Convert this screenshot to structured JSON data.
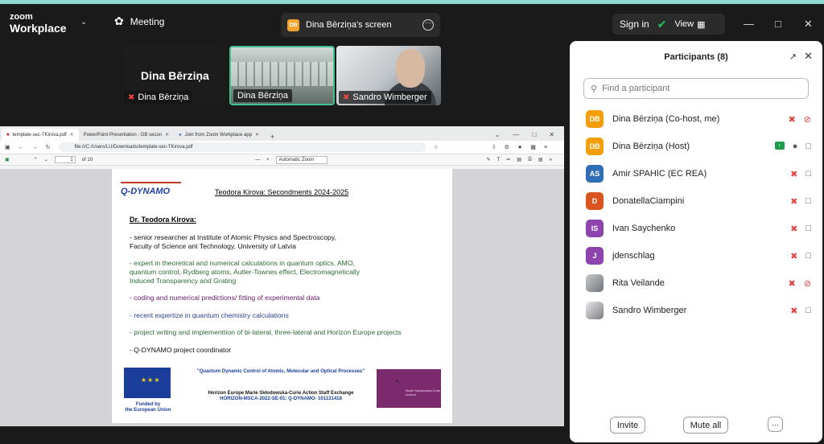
{
  "app": {
    "brand_top": "zoom",
    "brand_bottom": "Workplace",
    "meeting_label": "Meeting",
    "share_badge": "DB",
    "share_title": "Dina Bērziņa's screen",
    "sign_in": "Sign in",
    "view": "View"
  },
  "thumbs": [
    {
      "big_name": "Dina Bērziņa",
      "tag": "Dina Bērziņa"
    },
    {
      "tag": "Dina Bērziņa"
    },
    {
      "tag": "Sandro Wimberger"
    }
  ],
  "browser": {
    "tabs": [
      "template-sec-TKirova.pdf",
      "PowerPoint Presentation - DB secon",
      "Join from Zoom Workplace app"
    ],
    "url": "file:///C:/Users/LU/Downloads/template-sec-TKirova.pdf",
    "page_current": "1",
    "page_total": "of 10",
    "zoom": "Automatic Zoom"
  },
  "doc": {
    "logo": "Q-DYNAMO",
    "title": "Teodora Kirova: Secondments 2024-2025",
    "name": "Dr. Teodora Kirova:",
    "lines": [
      "- senior researcher at Institute of Atomic Physics and Spectroscopy,",
      "Faculty of Science ant Technology, University of Latvia",
      "- expert in theoretical and numerical calculations in quantum optics, AMO,",
      "quantum control, Rydberg atoms, Autler-Townes effect, Electromagnetically",
      "Induced Transparency and Grating",
      "- coding and numerical predictions/ fitting of experimental data",
      "- recent expertize in quantum chemistry calculations",
      "- project writing and implementtion of  bi-lateral, three-lateral and Horizon Europe projects",
      "- Q-DYNAMO project coordinator"
    ],
    "eu_caption_1": "Funded by",
    "eu_caption_2": "the European Union",
    "footer_title": "\"Quantum Dynamic Control of Atomic, Molecular and Optical Processes\"",
    "footer_sub1": "Horizon Europe Marie Skłodowska-Curie Action Staff Exchange",
    "footer_sub2": "HORIZON-MSCA-2022-SE-01: Q-DYNAMO- 101131418",
    "msca_label": "Marie Skłodowska-Curie Actions"
  },
  "panel": {
    "title": "Participants (8)",
    "search_placeholder": "Find a participant",
    "participants": [
      {
        "initials": "DB",
        "color": "#f59e0b",
        "name": "Dina Bērziņa (Co-host, me)",
        "mic": "off",
        "video": "off"
      },
      {
        "initials": "DB",
        "color": "#f59e0b",
        "name": "Dina Bērziņa (Host)",
        "mic": "on",
        "video": "on",
        "sharing": true
      },
      {
        "initials": "AS",
        "color": "#2f6db5",
        "name": "Amir SPAHIC (EC REA)",
        "mic": "off",
        "video": "on"
      },
      {
        "initials": "D",
        "color": "#d9541e",
        "name": "DonatellaCiampini",
        "mic": "off",
        "video": "on"
      },
      {
        "initials": "IS",
        "color": "#8e44ad",
        "name": "Ivan Saychenko",
        "mic": "off",
        "video": "on"
      },
      {
        "initials": "J",
        "color": "#8e44ad",
        "name": "jdenschlag",
        "mic": "off",
        "video": "on"
      },
      {
        "initials": "",
        "color": "photo1",
        "name": "Rita Veilande",
        "mic": "off",
        "video": "off"
      },
      {
        "initials": "",
        "color": "photo2",
        "name": "Sandro Wimberger",
        "mic": "off",
        "video": "on"
      }
    ],
    "invite": "Invite",
    "mute_all": "Mute all",
    "more": "···"
  }
}
